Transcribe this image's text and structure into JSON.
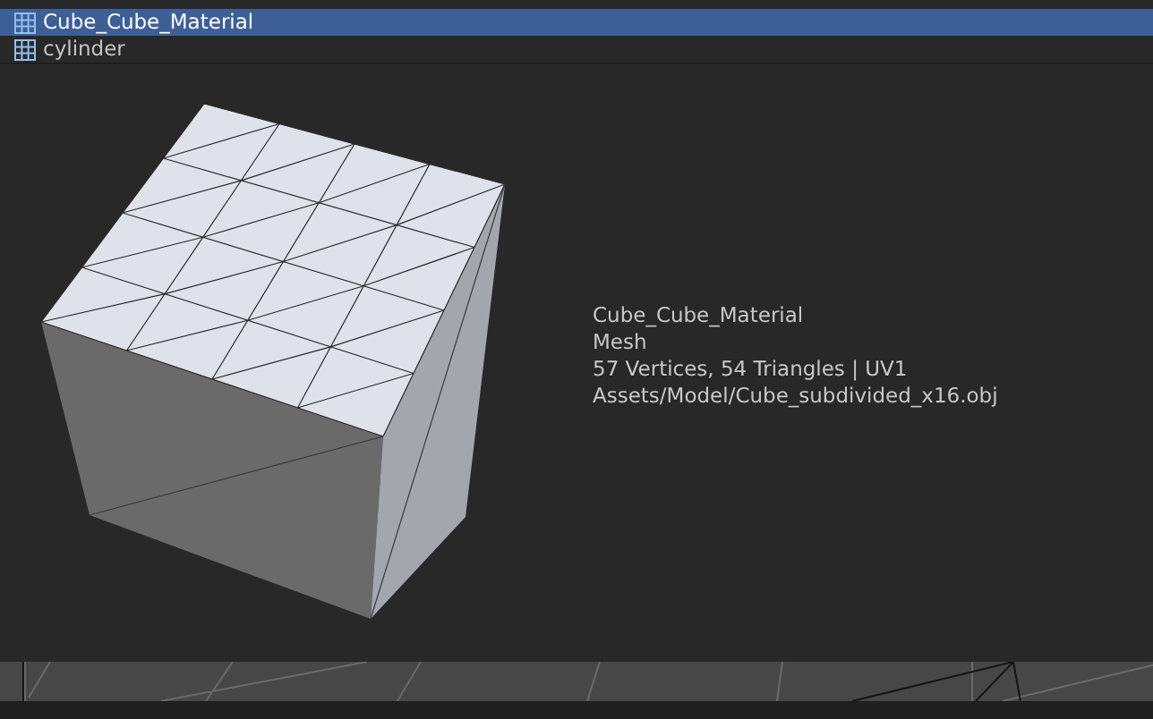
{
  "asset_list": [
    {
      "name": "Cube_Cube_Material",
      "selected": true
    },
    {
      "name": "cylinder",
      "selected": false
    }
  ],
  "preview_info": [
    "Cube_Cube_Material",
    "Mesh",
    "57 Vertices, 54 Triangles | UV1",
    "Assets/Model/Cube_subdivided_x16.obj"
  ]
}
